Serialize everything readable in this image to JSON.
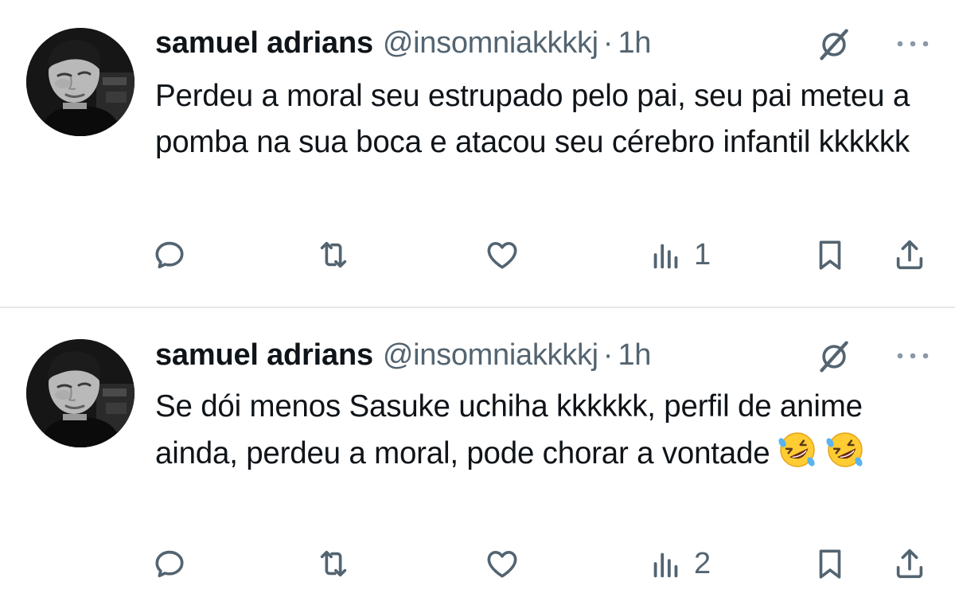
{
  "tweets": [
    {
      "display_name": "samuel adrians",
      "handle": "@insomniakkkkj",
      "separator": "·",
      "time": "1h",
      "text": "Perdeu a moral seu estrupado pelo pai, seu pai meteu a pomba na sua boca e atacou seu cérebro infantil kkkkkk",
      "emojis": [],
      "views": "1"
    },
    {
      "display_name": "samuel adrians",
      "handle": "@insomniakkkkj",
      "separator": "·",
      "time": "1h",
      "text": "Se dói menos Sasuke uchiha kkkkkk, perfil de anime ainda, perdeu a moral, pode chorar a vontade",
      "emojis": [
        "rolling-on-floor-laughing",
        "rolling-on-floor-laughing"
      ],
      "views": "2"
    }
  ],
  "colors": {
    "text": "#0f1419",
    "secondary": "#536471",
    "divider": "#e6e9ec"
  },
  "icons": {
    "reply": "reply-icon",
    "retweet": "retweet-icon",
    "like": "heart-icon",
    "views": "views-icon",
    "bookmark": "bookmark-icon",
    "share": "share-icon",
    "grok": "grok-icon",
    "more": "more-icon"
  }
}
